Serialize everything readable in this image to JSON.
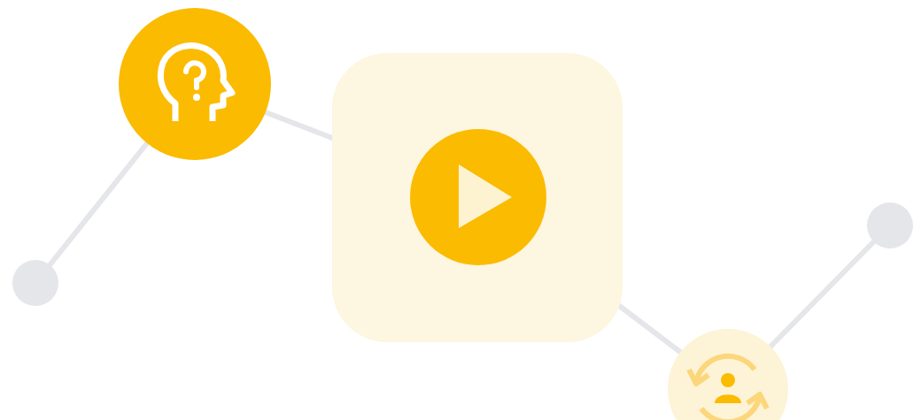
{
  "nodes": [
    {
      "kind": "dot"
    },
    {
      "kind": "help"
    },
    {
      "kind": "play"
    },
    {
      "kind": "user-sync"
    },
    {
      "kind": "dot"
    }
  ]
}
